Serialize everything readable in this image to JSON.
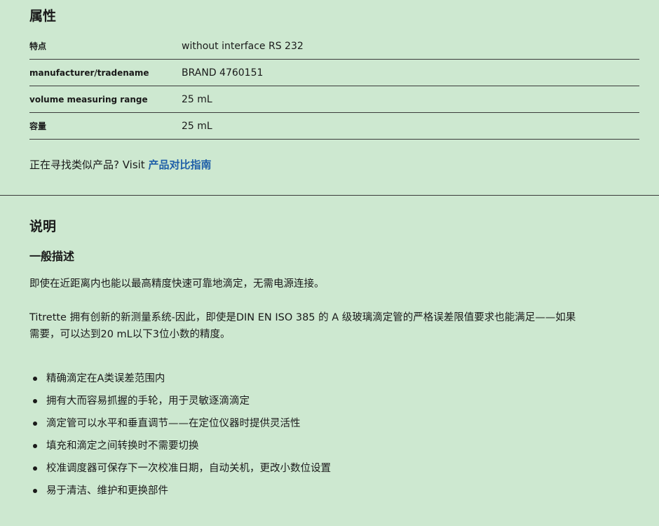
{
  "properties": {
    "heading": "属性",
    "rows": [
      {
        "key": "特点",
        "value": "without interface RS 232"
      },
      {
        "key": "manufacturer/tradename",
        "value": "BRAND 4760151"
      },
      {
        "key": "volume measuring range",
        "value": "25 mL"
      },
      {
        "key": "容量",
        "value": "25 mL"
      }
    ],
    "compare_prefix": "正在寻找类似产品? Visit ",
    "compare_link": "产品对比指南"
  },
  "description": {
    "heading": "说明",
    "subheading": "一般描述",
    "paragraph1": "即使在近距离内也能以最高精度快速可靠地滴定，无需电源连接。",
    "paragraph2": "Titrette 拥有创新的新测量系统-因此，即使是DIN EN ISO 385 的 A 级玻璃滴定管的严格误差限值要求也能满足——如果需要，可以达到20 mL以下3位小数的精度。",
    "features": [
      "精确滴定在A类误差范围内",
      "拥有大而容易抓握的手轮，用于灵敏逐滴滴定",
      "滴定管可以水平和垂直调节——在定位仪器时提供灵活性",
      "填充和滴定之间转换时不需要切换",
      "校准调度器可保存下一次校准日期，自动关机，更改小数位设置",
      "易于清洁、维护和更换部件"
    ]
  },
  "colors": {
    "background": "#cde8d0",
    "link": "#1f5fa8",
    "text": "#1a1a1a"
  }
}
